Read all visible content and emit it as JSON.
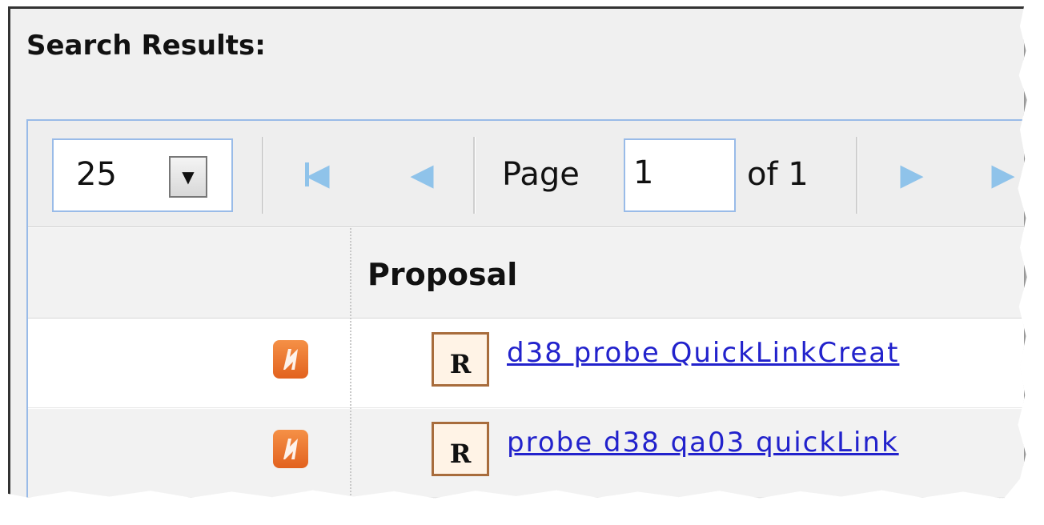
{
  "title": "Search Results:",
  "toolbar": {
    "page_size": "25",
    "page_label": "Page",
    "page_value": "1",
    "of_label": "of 1"
  },
  "columns": {
    "proposal": "Proposal"
  },
  "rows": [
    {
      "badge": "R",
      "link": "d38 probe QuickLinkCreat"
    },
    {
      "badge": "R",
      "link": "probe d38 qa03 quickLink"
    }
  ],
  "colors": {
    "accent_border": "#99bbe8",
    "nav_arrow": "#8fc3ea",
    "icon_orange": "#e2621f",
    "link": "#2222cc"
  }
}
